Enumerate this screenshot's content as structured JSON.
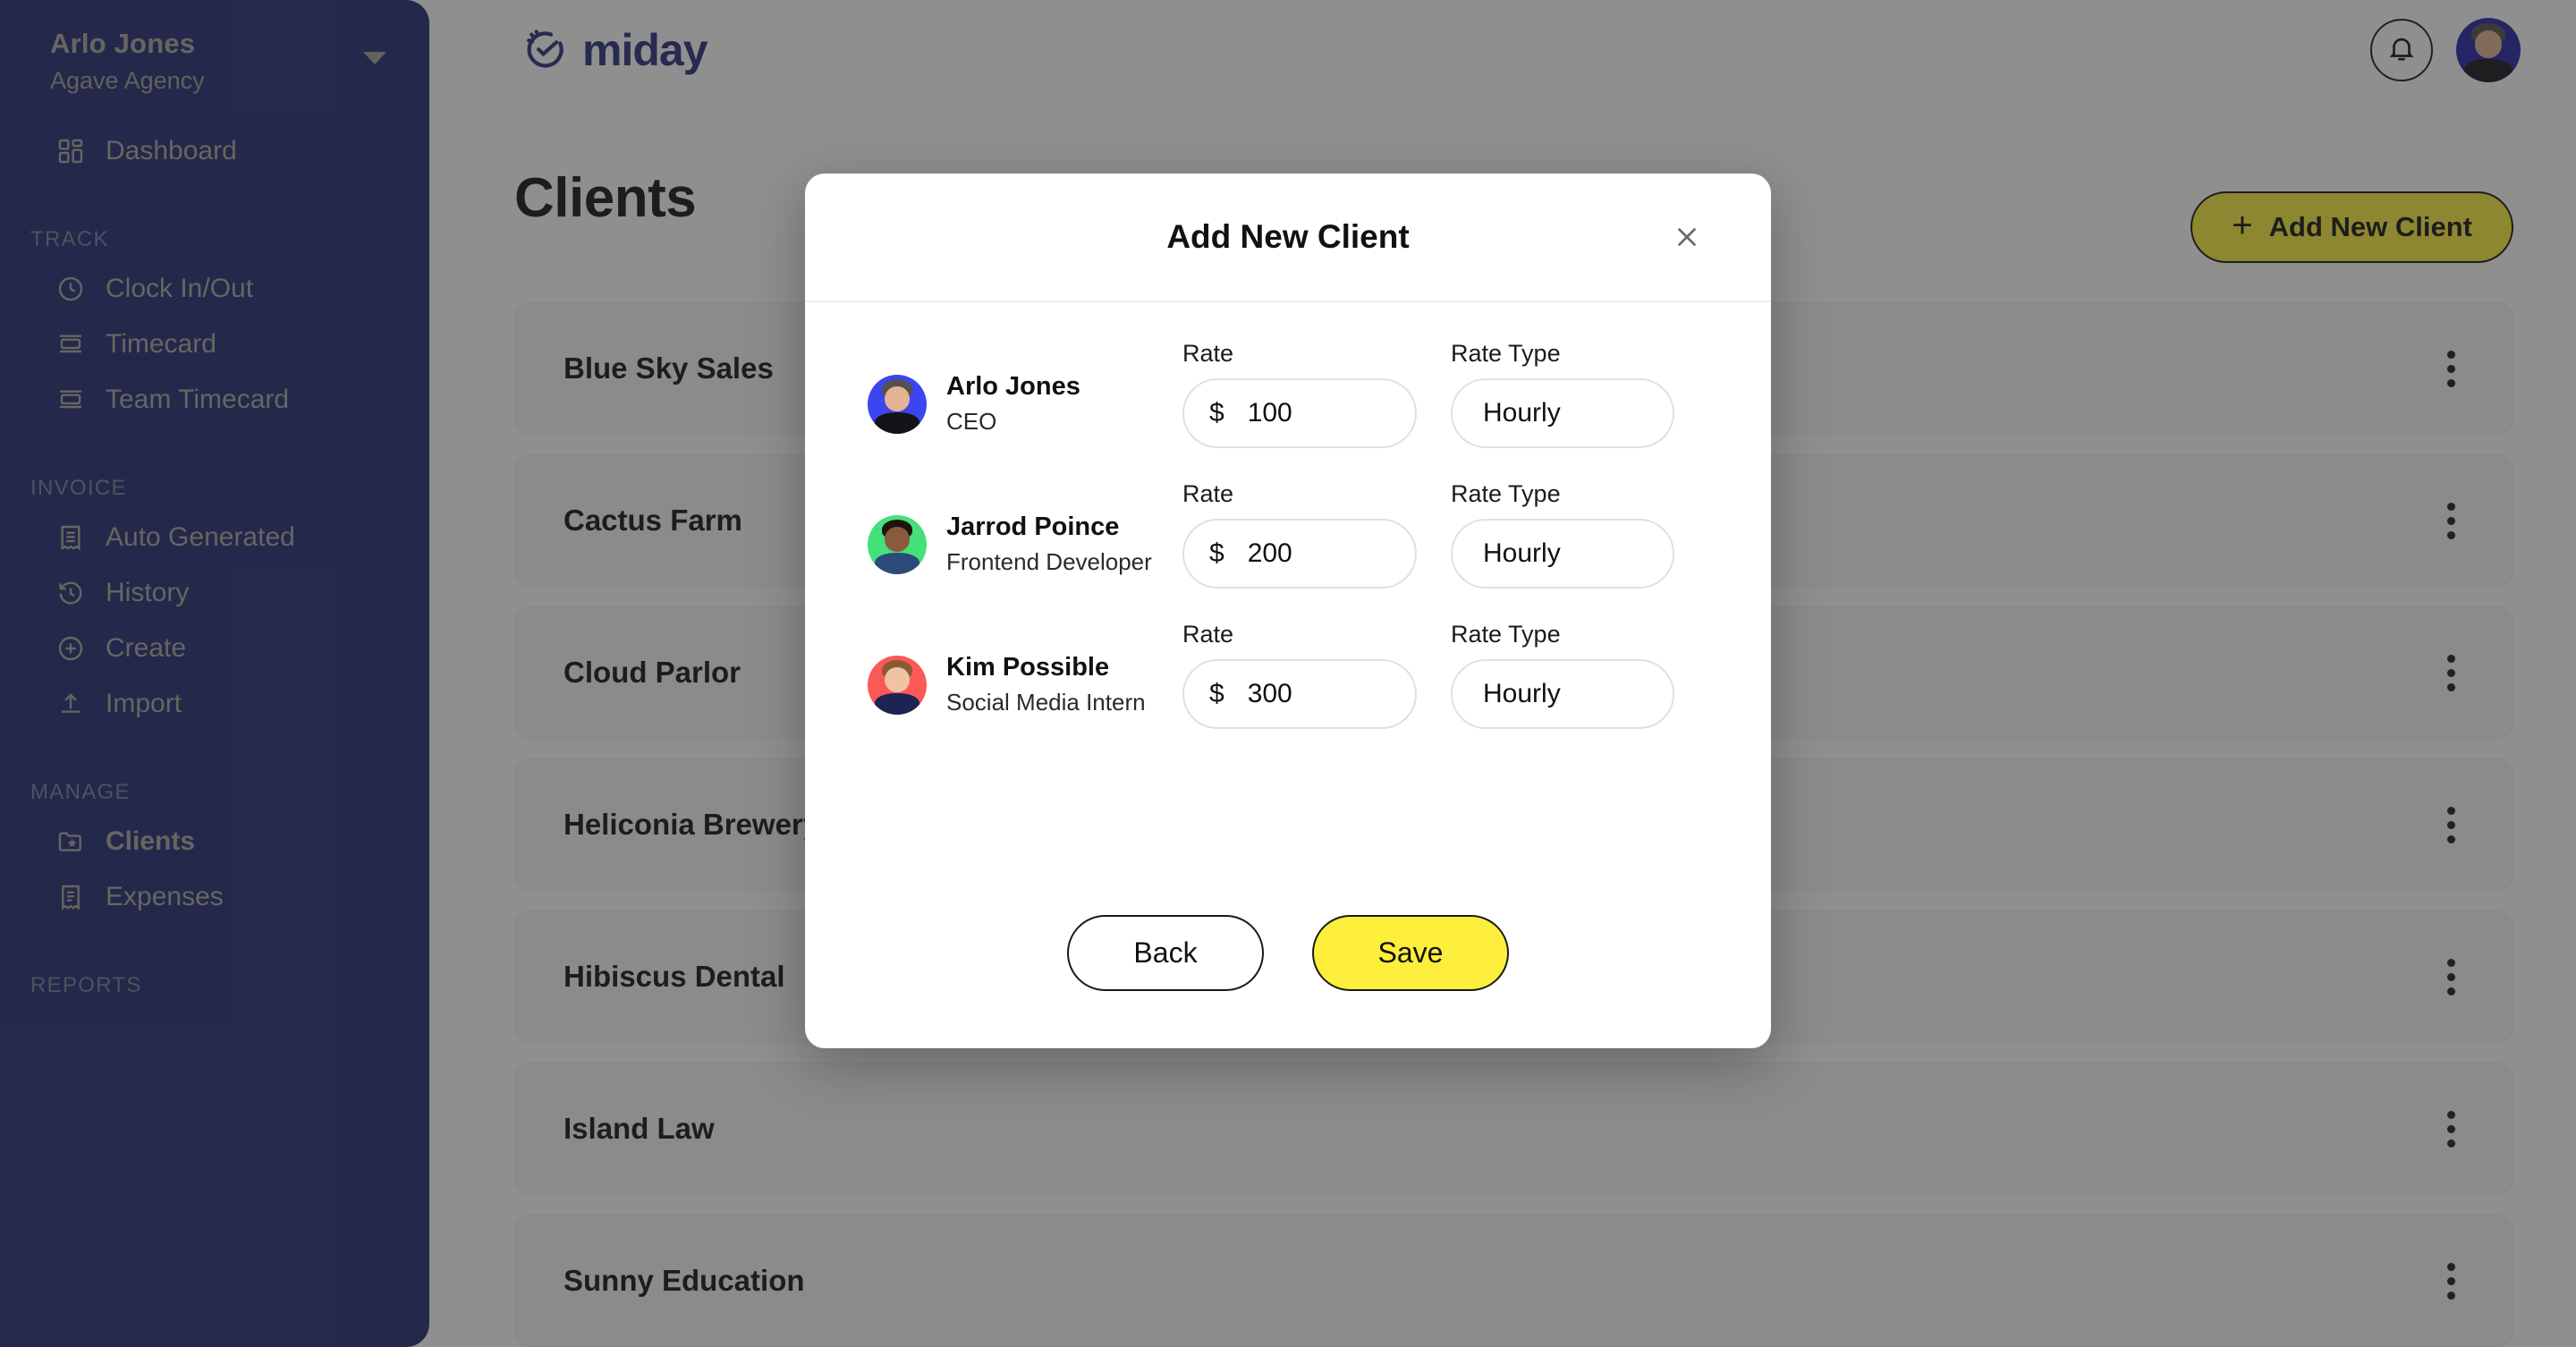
{
  "sidebar": {
    "user": {
      "name": "Arlo Jones",
      "org": "Agave Agency"
    },
    "dashboard": {
      "label": "Dashboard",
      "icon": "dashboard-grid-icon"
    },
    "groups": [
      {
        "label": "TRACK",
        "items": [
          {
            "label": "Clock In/Out",
            "icon": "clock-icon",
            "active": false
          },
          {
            "label": "Timecard",
            "icon": "timecard-icon",
            "active": false
          },
          {
            "label": "Team Timecard",
            "icon": "team-timecard-icon",
            "active": false
          }
        ]
      },
      {
        "label": "INVOICE",
        "items": [
          {
            "label": "Auto Generated",
            "icon": "receipt-icon",
            "active": false
          },
          {
            "label": "History",
            "icon": "history-icon",
            "active": false
          },
          {
            "label": "Create",
            "icon": "plus-circle-icon",
            "active": false
          },
          {
            "label": "Import",
            "icon": "upload-icon",
            "active": false
          }
        ]
      },
      {
        "label": "MANAGE",
        "items": [
          {
            "label": "Clients",
            "icon": "folder-star-icon",
            "active": true
          },
          {
            "label": "Expenses",
            "icon": "expense-receipt-icon",
            "active": false
          }
        ]
      },
      {
        "label": "REPORTS",
        "items": []
      }
    ]
  },
  "topbar": {
    "logo_text": "miday",
    "logo_icon": "clock-check-icon",
    "notification_icon": "bell-icon",
    "avatar": "user-avatar"
  },
  "page": {
    "title": "Clients",
    "add_button": {
      "label": "Add New Client",
      "icon": "plus-icon"
    },
    "clients": [
      {
        "name": "Blue Sky Sales"
      },
      {
        "name": "Cactus Farm"
      },
      {
        "name": "Cloud Parlor"
      },
      {
        "name": "Heliconia Brewery"
      },
      {
        "name": "Hibiscus Dental"
      },
      {
        "name": "Island Law"
      },
      {
        "name": "Sunny Education"
      }
    ],
    "row_menu_icon": "kebab-menu-icon"
  },
  "modal": {
    "title": "Add New Client",
    "close_icon": "close-icon",
    "labels": {
      "rate": "Rate",
      "rate_type": "Rate Type",
      "currency": "$"
    },
    "employees": [
      {
        "name": "Arlo Jones",
        "role": "CEO",
        "rate": "100",
        "rate_type": "Hourly",
        "avatar_color": "#3b46f0",
        "hair_color": "#55504c",
        "shirt_color": "#141418"
      },
      {
        "name": "Jarrod Poince",
        "role": "Frontend Developer",
        "rate": "200",
        "rate_type": "Hourly",
        "avatar_color": "#44e07a",
        "hair_color": "#1d1410",
        "shirt_color": "#2c4a7a"
      },
      {
        "name": "Kim Possible",
        "role": "Social Media Intern",
        "rate": "300",
        "rate_type": "Hourly",
        "avatar_color": "#fb5858",
        "hair_color": "#8a5a33",
        "shirt_color": "#1b2452"
      }
    ],
    "back_label": "Back",
    "save_label": "Save"
  },
  "colors": {
    "sidebar_bg": "#212a72",
    "brand_navy": "#262f7c",
    "accent_yellow": "#fdee3c",
    "sidebar_text": "#aaa9a0"
  }
}
